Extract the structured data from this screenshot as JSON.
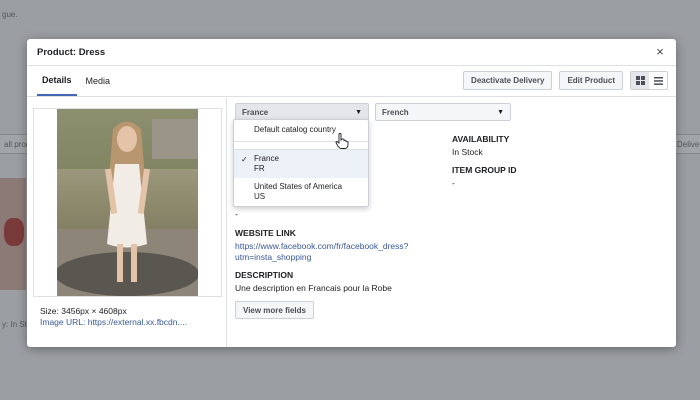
{
  "background": {
    "frag_top": "gue.",
    "frag_left_filter": "all prod",
    "frag_left_bottom": "y: In Sto",
    "frag_right": "Delive"
  },
  "modal": {
    "title": "Product: Dress",
    "close_label": "×",
    "tabs": [
      "Details",
      "Media"
    ],
    "active_tab": "Details",
    "actions": {
      "deactivate": "Deactivate Delivery",
      "edit": "Edit Product"
    },
    "view_icons": {
      "grid": "grid-view-icon",
      "list": "list-view-icon"
    }
  },
  "image": {
    "size_text": "Size: 3456px × 4608px",
    "url_text": "Image URL: https://external.xx.fbcdn...."
  },
  "selectors": {
    "country": "France",
    "language": "French"
  },
  "country_dropdown": {
    "items": [
      {
        "label": "Default catalog country",
        "sub": ""
      },
      {
        "label": "France",
        "sub": "FR",
        "selected": true
      },
      {
        "label": "United States of America",
        "sub": "US"
      }
    ]
  },
  "fields": {
    "availability_label": "AVAILABILITY",
    "availability_value": "In Stock",
    "group_id_label": "ITEM GROUP ID",
    "group_id_value": "-",
    "hidden_value": "-",
    "website_label": "WEBSITE LINK",
    "website_line1": "https://www.facebook.com/fr/facebook_dress?",
    "website_line2": "utm=insta_shopping",
    "description_label": "DESCRIPTION",
    "description_value": "Une description en Francais pour la Robe",
    "more_button": "View more fields"
  },
  "colors": {
    "link": "#385898",
    "accent": "#4267b2",
    "selected_bg": "#ecf0f7"
  }
}
